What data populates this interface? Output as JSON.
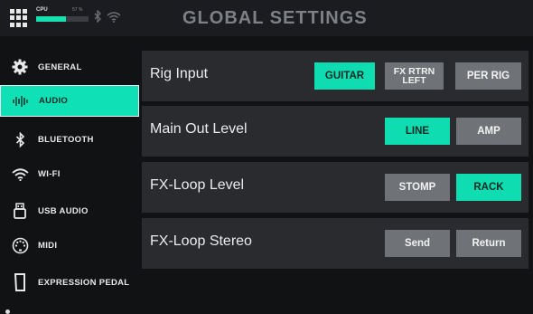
{
  "topbar": {
    "title": "GLOBAL SETTINGS",
    "cpu_label": "CPU",
    "cpu_value": "57 %",
    "cpu_fraction": 0.57,
    "bluetooth_icon": "bluetooth-icon",
    "wifi_icon": "wifi-icon"
  },
  "sidebar": {
    "items": [
      {
        "label": "GENERAL",
        "icon": "gear-icon"
      },
      {
        "label": "AUDIO",
        "icon": "waveform-icon",
        "active": true
      },
      {
        "label": "BLUETOOTH",
        "icon": "bluetooth-icon"
      },
      {
        "label": "WI-FI",
        "icon": "wifi-icon"
      },
      {
        "label": "USB AUDIO",
        "icon": "usb-icon"
      },
      {
        "label": "MIDI",
        "icon": "midi-icon"
      },
      {
        "label": "EXPRESSION PEDAL",
        "icon": "pedal-icon"
      }
    ]
  },
  "settings": [
    {
      "label": "Rig Input",
      "options": [
        "GUITAR",
        "FX RTRN\nLEFT",
        "PER RIG"
      ],
      "selected": "GUITAR"
    },
    {
      "label": "Main Out Level",
      "options": [
        "LINE",
        "AMP"
      ],
      "selected": "LINE"
    },
    {
      "label": "FX-Loop Level",
      "options": [
        "STOMP",
        "RACK"
      ],
      "selected": "RACK"
    },
    {
      "label": "FX-Loop Stereo",
      "options": [
        "Send",
        "Return"
      ],
      "selected": ""
    }
  ],
  "colors": {
    "accent": "#0fdcb0",
    "button_off": "#6f7277",
    "row_bg": "#2a2b2f",
    "background": "#111214"
  }
}
